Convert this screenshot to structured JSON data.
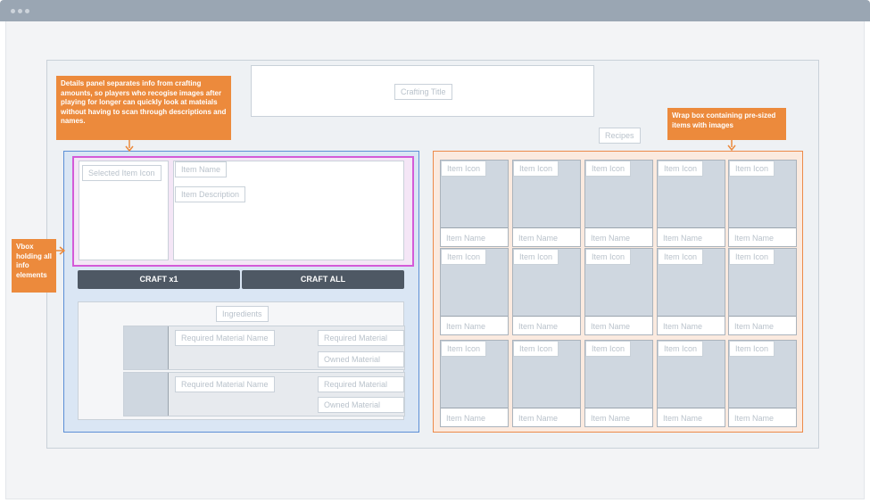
{
  "window": {
    "title": ""
  },
  "crafting_title": "Crafting Title",
  "recipes_label": "Recipes",
  "details": {
    "selected_item_icon": "Selected Item Icon",
    "item_name": "Item Name",
    "item_description": "Item Description"
  },
  "buttons": {
    "craft_one": "CRAFT x1",
    "craft_all": "CRAFT ALL"
  },
  "ingredients": {
    "label": "Ingredients",
    "rows": [
      {
        "name": "Required Material Name",
        "required": "Required Material",
        "owned": "Owned Material"
      },
      {
        "name": "Required Material Name",
        "required": "Required Material",
        "owned": "Owned Material"
      }
    ]
  },
  "recipes": [
    {
      "icon": "Item Icon",
      "name": "Item Name"
    },
    {
      "icon": "Item Icon",
      "name": "Item Name"
    },
    {
      "icon": "Item Icon",
      "name": "Item Name"
    },
    {
      "icon": "Item Icon",
      "name": "Item Name"
    },
    {
      "icon": "Item Icon",
      "name": "Item Name"
    },
    {
      "icon": "Item Icon",
      "name": "Item Name"
    },
    {
      "icon": "Item Icon",
      "name": "Item Name"
    },
    {
      "icon": "Item Icon",
      "name": "Item Name"
    },
    {
      "icon": "Item Icon",
      "name": "Item Name"
    },
    {
      "icon": "Item Icon",
      "name": "Item Name"
    },
    {
      "icon": "Item Icon",
      "name": "Item Name"
    },
    {
      "icon": "Item Icon",
      "name": "Item Name"
    },
    {
      "icon": "Item Icon",
      "name": "Item Name"
    },
    {
      "icon": "Item Icon",
      "name": "Item Name"
    },
    {
      "icon": "Item Icon",
      "name": "Item Name"
    }
  ],
  "callouts": {
    "details_panel": "Details panel separates info from crafting amounts, so players who recogise images after playing for longer can quickly look at mateials without having to scan through descriptions and names.",
    "wrap_box": "Wrap box containing pre-sized items with images",
    "vbox": "Vbox holding all info elements"
  },
  "colors": {
    "accent": "#ec8a3c",
    "button": "#4e5864",
    "vbox_border": "#5b8fd6",
    "details_border": "#d45ad8",
    "wrapbox_border": "#ec8a4a"
  }
}
